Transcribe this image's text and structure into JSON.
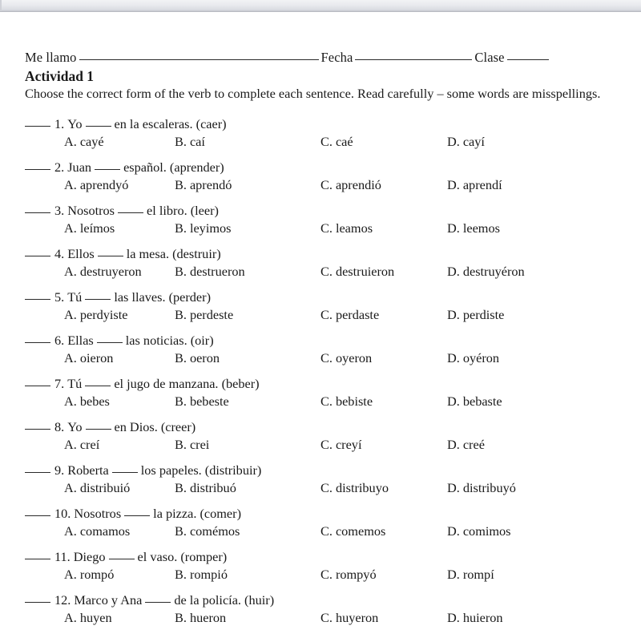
{
  "header": {
    "name_label": "Me llamo",
    "date_label": "Fecha",
    "class_label": "Clase"
  },
  "activity": {
    "title": "Actividad 1",
    "instructions": "Choose the correct form of the verb to complete each sentence.  Read carefully – some words are misspellings."
  },
  "questions": [
    {
      "number": "1.",
      "prompt_before": "Yo",
      "prompt_after": "en la escaleras.  (caer)",
      "options": [
        {
          "letter": "A.",
          "text": "cayé"
        },
        {
          "letter": "B.",
          "text": "caí"
        },
        {
          "letter": "C.",
          "text": "caé"
        },
        {
          "letter": "D.",
          "text": "cayí"
        }
      ]
    },
    {
      "number": "2.",
      "prompt_before": "Juan",
      "prompt_after": "español.  (aprender)",
      "options": [
        {
          "letter": "A.",
          "text": "aprendyó"
        },
        {
          "letter": "B.",
          "text": "aprendó"
        },
        {
          "letter": "C.",
          "text": "aprendió"
        },
        {
          "letter": "D.",
          "text": "aprendí"
        }
      ]
    },
    {
      "number": "3.",
      "prompt_before": "Nosotros",
      "prompt_after": "el libro.  (leer)",
      "options": [
        {
          "letter": "A.",
          "text": "leímos"
        },
        {
          "letter": "B.",
          "text": "leyimos"
        },
        {
          "letter": "C.",
          "text": "leamos"
        },
        {
          "letter": "D.",
          "text": "leemos"
        }
      ]
    },
    {
      "number": "4.",
      "prompt_before": "Ellos",
      "prompt_after": "la mesa.  (destruir)",
      "options": [
        {
          "letter": "A.",
          "text": "destruyeron"
        },
        {
          "letter": "B.",
          "text": "destrueron"
        },
        {
          "letter": "C.",
          "text": "destruieron"
        },
        {
          "letter": "D.",
          "text": "destruyéron"
        }
      ]
    },
    {
      "number": "5.",
      "prompt_before": "Tú",
      "prompt_after": "las llaves.  (perder)",
      "options": [
        {
          "letter": "A.",
          "text": "perdyiste"
        },
        {
          "letter": "B.",
          "text": "perdeste"
        },
        {
          "letter": "C.",
          "text": "perdaste"
        },
        {
          "letter": "D.",
          "text": "perdiste"
        }
      ]
    },
    {
      "number": "6.",
      "prompt_before": "Ellas",
      "prompt_after": "las noticias.  (oir)",
      "options": [
        {
          "letter": "A.",
          "text": "oieron"
        },
        {
          "letter": "B.",
          "text": "oeron"
        },
        {
          "letter": "C.",
          "text": "oyeron"
        },
        {
          "letter": "D.",
          "text": "oyéron"
        }
      ]
    },
    {
      "number": "7.",
      "prompt_before": "Tú",
      "prompt_after": "el jugo de manzana.  (beber)",
      "options": [
        {
          "letter": "A.",
          "text": "bebes"
        },
        {
          "letter": "B.",
          "text": "bebeste"
        },
        {
          "letter": "C.",
          "text": "bebiste"
        },
        {
          "letter": "D.",
          "text": "bebaste"
        }
      ]
    },
    {
      "number": "8.",
      "prompt_before": "Yo",
      "prompt_after": "en Dios.  (creer)",
      "options": [
        {
          "letter": "A.",
          "text": "creí"
        },
        {
          "letter": "B.",
          "text": "crei"
        },
        {
          "letter": "C.",
          "text": "creyí"
        },
        {
          "letter": "D.",
          "text": "creé"
        }
      ]
    },
    {
      "number": "9.",
      "prompt_before": "Roberta",
      "prompt_after": "los papeles.  (distribuir)",
      "options": [
        {
          "letter": "A.",
          "text": "distribuió"
        },
        {
          "letter": "B.",
          "text": "distribuó"
        },
        {
          "letter": "C.",
          "text": "distribuyo"
        },
        {
          "letter": "D.",
          "text": "distribuyó"
        }
      ]
    },
    {
      "number": "10.",
      "prompt_before": "Nosotros",
      "prompt_after": "la pizza.  (comer)",
      "options": [
        {
          "letter": "A.",
          "text": "comamos"
        },
        {
          "letter": "B.",
          "text": "comémos"
        },
        {
          "letter": "C.",
          "text": "comemos"
        },
        {
          "letter": "D.",
          "text": "comimos"
        }
      ]
    },
    {
      "number": "11.",
      "prompt_before": "Diego",
      "prompt_after": "el vaso.  (romper)",
      "options": [
        {
          "letter": "A.",
          "text": "rompó"
        },
        {
          "letter": "B.",
          "text": "rompió"
        },
        {
          "letter": "C.",
          "text": "rompyó"
        },
        {
          "letter": "D.",
          "text": "rompí"
        }
      ]
    },
    {
      "number": "12.",
      "prompt_before": "Marco y Ana",
      "prompt_after": "de la policía.  (huir)",
      "options": [
        {
          "letter": "A.",
          "text": "huyen"
        },
        {
          "letter": "B.",
          "text": "hueron"
        },
        {
          "letter": "C.",
          "text": "huyeron"
        },
        {
          "letter": "D.",
          "text": "huieron"
        }
      ]
    }
  ]
}
